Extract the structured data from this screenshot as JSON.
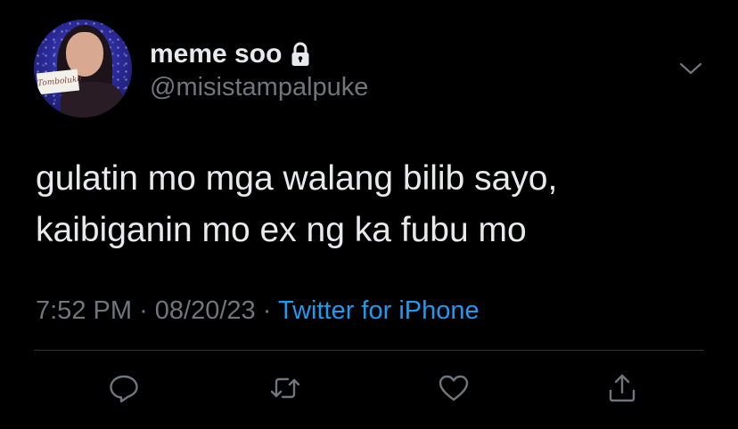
{
  "user": {
    "display_name": "meme soo",
    "handle": "@misistampalpuke",
    "avatar_sign_text": "Tomboluke",
    "locked_icon": "lock-icon"
  },
  "tweet": {
    "lines": [
      "gulatin mo mga walang bilib sayo,",
      "kaibiganin mo ex ng ka fubu mo"
    ]
  },
  "meta": {
    "time": "7:52 PM",
    "separator": "·",
    "date": "08/20/23",
    "source": "Twitter for iPhone"
  },
  "actions": [
    {
      "icon": "reply-icon"
    },
    {
      "icon": "retweet-icon"
    },
    {
      "icon": "like-icon"
    },
    {
      "icon": "share-icon"
    }
  ],
  "colors": {
    "background": "#000000",
    "text": "#e7e9ea",
    "secondary": "#71767b",
    "link": "#1d9bf0",
    "divider": "#2f3336"
  }
}
